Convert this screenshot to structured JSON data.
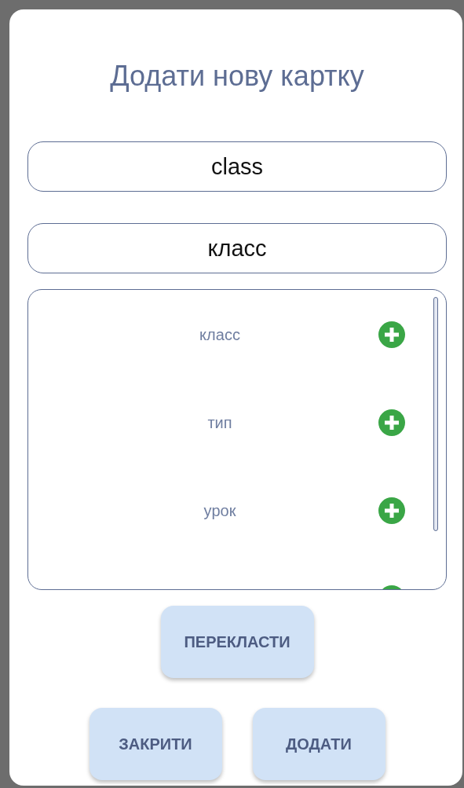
{
  "dialog": {
    "title": "Додати нову картку"
  },
  "fields": [
    {
      "value": "class"
    },
    {
      "value": "класс"
    }
  ],
  "suggestions": [
    {
      "kind": "word",
      "label": "класс"
    },
    {
      "kind": "word",
      "label": "тип"
    },
    {
      "kind": "word",
      "label": "урок"
    },
    {
      "kind": "partial"
    }
  ],
  "primary_button": "ПЕРЕКЛАСТИ",
  "buttons": [
    "ЗАКРИТИ",
    "ДОДАТИ"
  ]
}
